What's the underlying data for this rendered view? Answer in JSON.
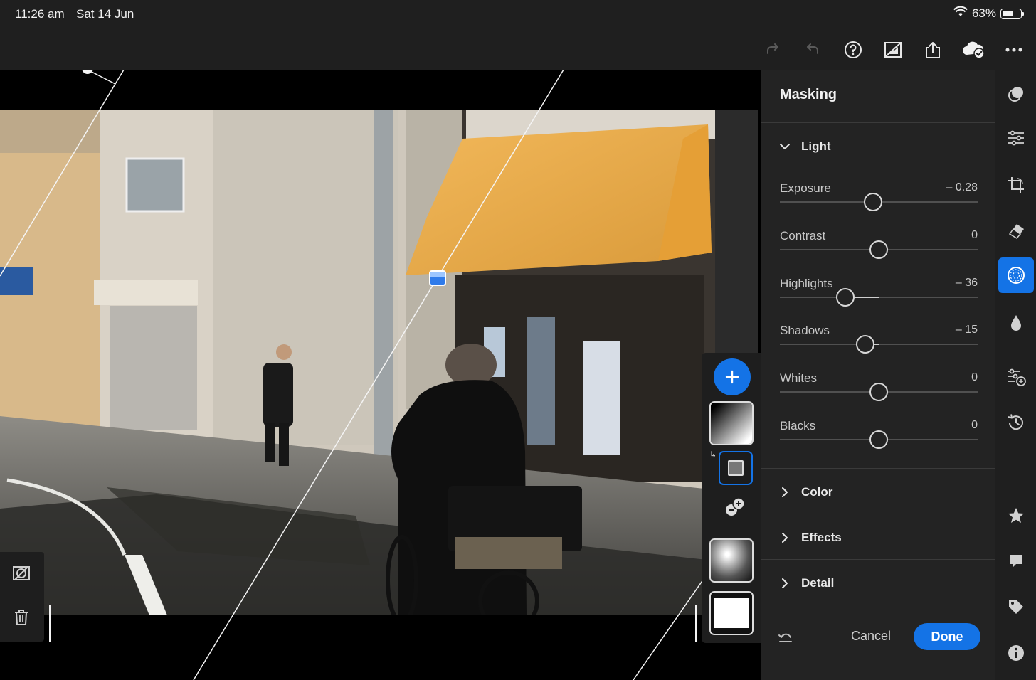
{
  "status_bar": {
    "time": "11:26 am",
    "date": "Sat 14 Jun",
    "battery": "63%",
    "battery_level": 0.63
  },
  "toolbar": {
    "icons": [
      "redo-icon",
      "undo-icon",
      "help-icon",
      "compare-icon",
      "share-icon",
      "cloud-sync-icon",
      "more-icon"
    ]
  },
  "panel": {
    "title": "Masking",
    "light": {
      "label": "Light",
      "sliders": [
        {
          "name": "exposure",
          "label": "Exposure",
          "value": "– 0.28",
          "position": 0.47
        },
        {
          "name": "contrast",
          "label": "Contrast",
          "value": "0",
          "position": 0.5
        },
        {
          "name": "highlights",
          "label": "Highlights",
          "value": "– 36",
          "position": 0.33
        },
        {
          "name": "shadows",
          "label": "Shadows",
          "value": "– 15",
          "position": 0.43
        },
        {
          "name": "whites",
          "label": "Whites",
          "value": "0",
          "position": 0.5
        },
        {
          "name": "blacks",
          "label": "Blacks",
          "value": "0",
          "position": 0.5
        }
      ]
    },
    "sections": [
      {
        "name": "color",
        "label": "Color"
      },
      {
        "name": "effects",
        "label": "Effects"
      },
      {
        "name": "detail",
        "label": "Detail"
      }
    ],
    "cancel_label": "Cancel",
    "done_label": "Done"
  },
  "rail": {
    "icons": [
      "presets-icon",
      "edit-icon",
      "crop-icon",
      "healing-icon",
      "masking-icon",
      "blur-icon",
      "versions-adjust-icon",
      "history-icon",
      "star-icon",
      "comment-icon",
      "tag-icon",
      "info-icon"
    ],
    "active": "masking-icon"
  },
  "colors": {
    "accent": "#1473e6",
    "panel_bg": "#232323",
    "toolbar_bg": "#1f1f1f"
  }
}
